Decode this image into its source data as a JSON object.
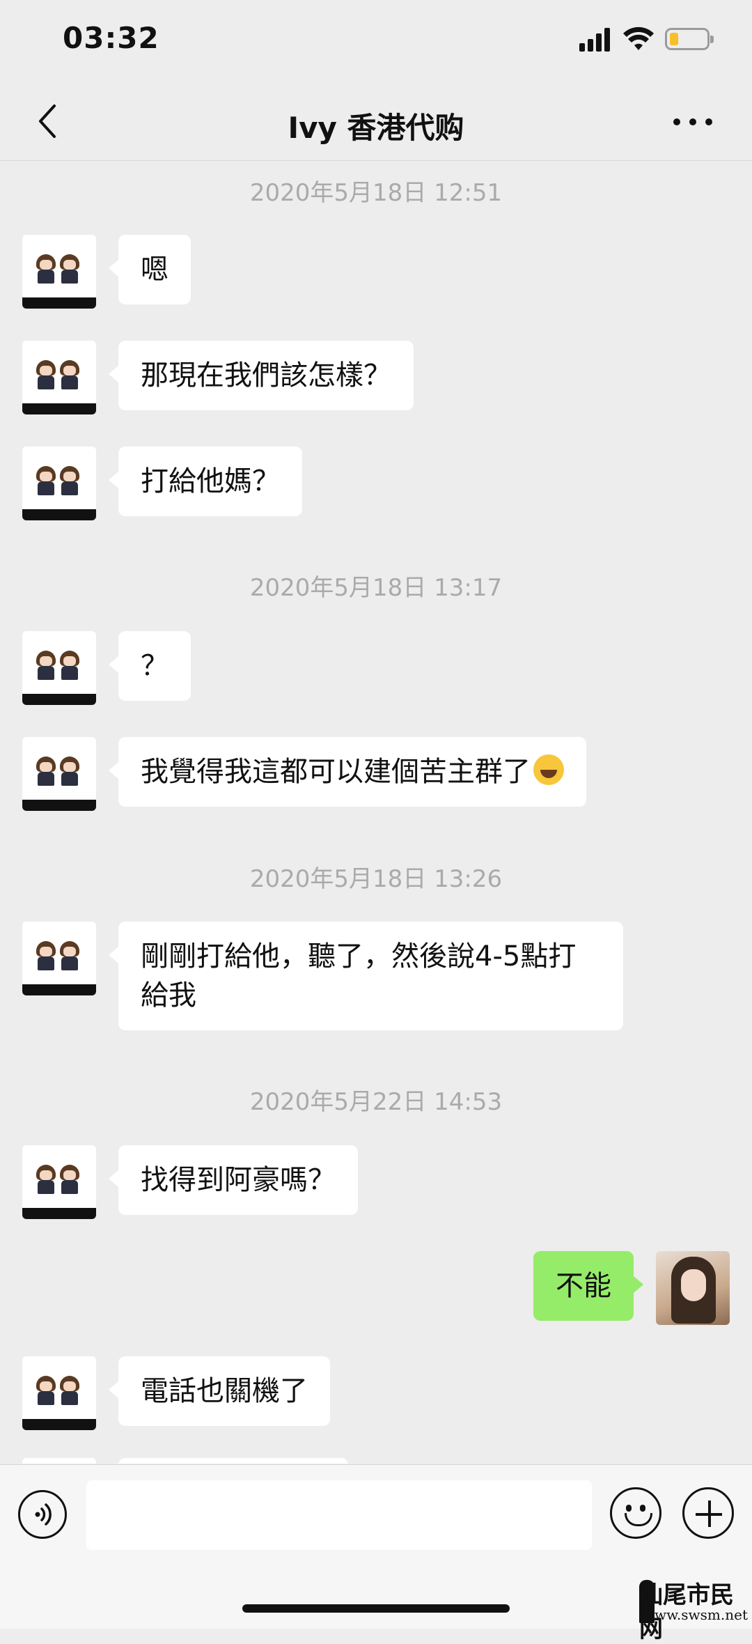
{
  "status_bar": {
    "time": "03:32",
    "battery_color": "#f5c02a"
  },
  "nav": {
    "title": "Ivy 香港代购",
    "back_icon": "chevron-left-icon",
    "more_icon": "more-dots-icon"
  },
  "timestamps": [
    "2020年5月18日 12:51",
    "2020年5月18日 13:17",
    "2020年5月18日 13:26",
    "2020年5月22日 14:53"
  ],
  "messages": [
    {
      "from": "contact",
      "text": "嗯"
    },
    {
      "from": "contact",
      "text": "那現在我們該怎樣？"
    },
    {
      "from": "contact",
      "text": "打給他媽？"
    },
    {
      "from": "contact",
      "text": "？"
    },
    {
      "from": "contact",
      "text": "我覺得我這都可以建個苦主群了"
    },
    {
      "from": "contact",
      "text": "剛剛打給他，聽了，然後說4-5點打給我"
    },
    {
      "from": "contact",
      "text": "找得到阿豪嗎？"
    },
    {
      "from": "me",
      "text": "不能"
    },
    {
      "from": "contact",
      "text": "電話也關機了"
    }
  ],
  "input_bar": {
    "voice_icon": "voice-icon",
    "emoji_icon": "emoji-icon",
    "plus_icon": "plus-icon",
    "placeholder": ""
  },
  "watermark": {
    "name": "汕尾市民网",
    "url": "www.swsm.net"
  },
  "colors": {
    "background": "#ededed",
    "my_bubble": "#95ec69",
    "other_bubble": "#ffffff"
  }
}
